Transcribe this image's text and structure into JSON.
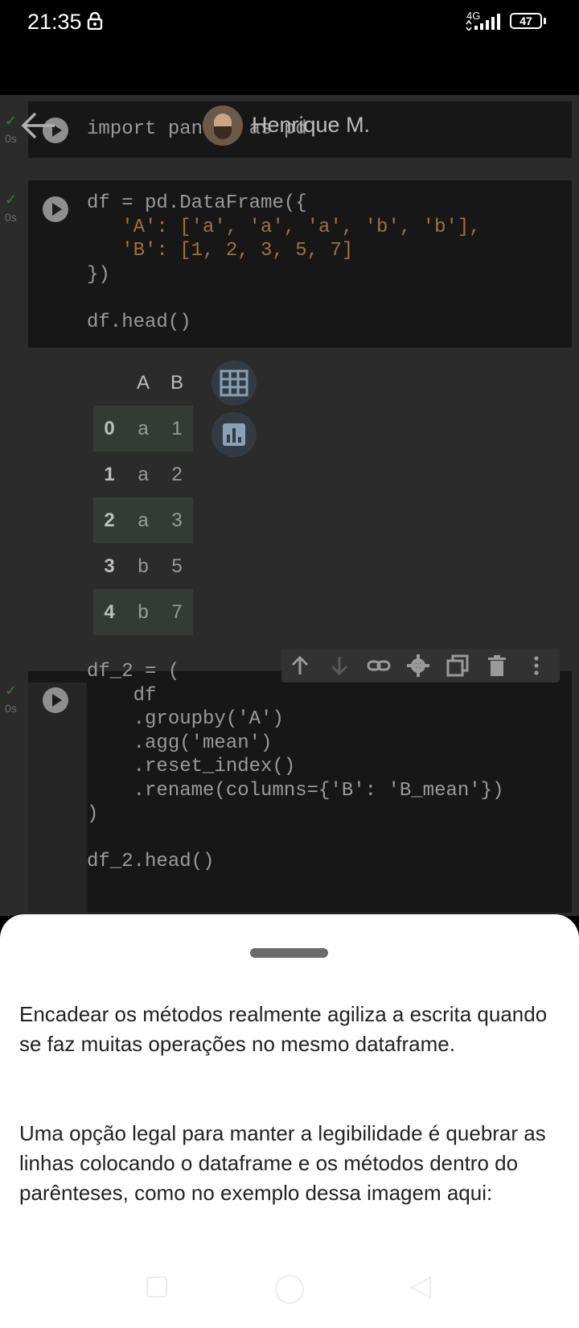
{
  "status_bar": {
    "time": "21:35",
    "network": "4G",
    "battery": "47"
  },
  "header": {
    "name": "Henrique M."
  },
  "cells": [
    {
      "status": "0s",
      "code": "import pandas as pd"
    },
    {
      "status": "0s",
      "code_lines": [
        "df = pd.DataFrame({",
        "   'A': ['a', 'a', 'a', 'b', 'b'],",
        "   'B': [1, 2, 3, 5, 7]",
        "})",
        "",
        "df.head()"
      ]
    },
    {
      "status": "0s",
      "code_lines": [
        "df_2 = (",
        "    df",
        "    .groupby('A')",
        "    .agg('mean')",
        "    .reset_index()",
        "    .rename(columns={'B': 'B_mean'})",
        ")",
        "",
        "df_2.head()"
      ]
    }
  ],
  "dataframe": {
    "columns": [
      "A",
      "B"
    ],
    "rows": [
      {
        "idx": "0",
        "a": "a",
        "b": "1"
      },
      {
        "idx": "1",
        "a": "a",
        "b": "2"
      },
      {
        "idx": "2",
        "a": "a",
        "b": "3"
      },
      {
        "idx": "3",
        "a": "b",
        "b": "5"
      },
      {
        "idx": "4",
        "a": "b",
        "b": "7"
      }
    ]
  },
  "cell_toolbar": {
    "icons": [
      "arrow-up-icon",
      "arrow-down-icon",
      "link-icon",
      "gear-icon",
      "mirror-cell-icon",
      "trash-icon",
      "more-vertical-icon"
    ]
  },
  "sheet": {
    "paragraph1": "Encadear os métodos realmente agiliza a escrita quando se faz muitas operações no mesmo dataframe.",
    "paragraph2": "Uma opção legal para manter a legibilidade é quebrar as linhas colocando o dataframe e os métodos dentro do parênteses, como no exemplo dessa imagem aqui:"
  }
}
